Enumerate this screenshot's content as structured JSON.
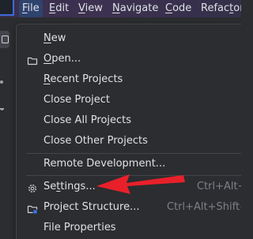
{
  "menubar": {
    "items": [
      {
        "pre": "",
        "mn": "F",
        "post": "ile"
      },
      {
        "pre": "",
        "mn": "E",
        "post": "dit"
      },
      {
        "pre": "",
        "mn": "V",
        "post": "iew"
      },
      {
        "pre": "",
        "mn": "N",
        "post": "avigate"
      },
      {
        "pre": "",
        "mn": "C",
        "post": "ode"
      },
      {
        "pre": "Refac",
        "mn": "t",
        "post": "or"
      }
    ]
  },
  "file_menu": {
    "items": [
      {
        "pre": "",
        "mn": "N",
        "post": "ew",
        "shortcut": "",
        "icon": ""
      },
      {
        "pre": "",
        "mn": "O",
        "post": "pen...",
        "shortcut": "",
        "icon": "folder-icon"
      },
      {
        "pre": "",
        "mn": "R",
        "post": "ecent Projects",
        "shortcut": "",
        "icon": ""
      },
      {
        "pre": "Close Project",
        "mn": "",
        "post": "",
        "shortcut": "",
        "icon": ""
      },
      {
        "pre": "Close All Projects",
        "mn": "",
        "post": "",
        "shortcut": "",
        "icon": ""
      },
      {
        "pre": "Close Other Projects",
        "mn": "",
        "post": "",
        "shortcut": "",
        "icon": ""
      },
      {
        "pre": "Remote Development...",
        "mn": "",
        "post": "",
        "shortcut": "",
        "icon": ""
      },
      {
        "pre": "Se",
        "mn": "t",
        "post": "tings...",
        "shortcut": "Ctrl+Alt+",
        "icon": "gear-icon"
      },
      {
        "pre": "Project Structure...",
        "mn": "",
        "post": "",
        "shortcut": "Ctrl+Alt+Shift+",
        "icon": "project-structure-icon"
      },
      {
        "pre": "File Properties",
        "mn": "",
        "post": "",
        "shortcut": "",
        "icon": ""
      }
    ]
  },
  "colors": {
    "menubar_bg": "#3a2f4e",
    "active_menu_bg": "#2e436e",
    "popup_bg": "#2b2d30",
    "text": "#dfe1e5",
    "shortcut_text": "#7d8088",
    "annotation_arrow": "#e8202a"
  }
}
